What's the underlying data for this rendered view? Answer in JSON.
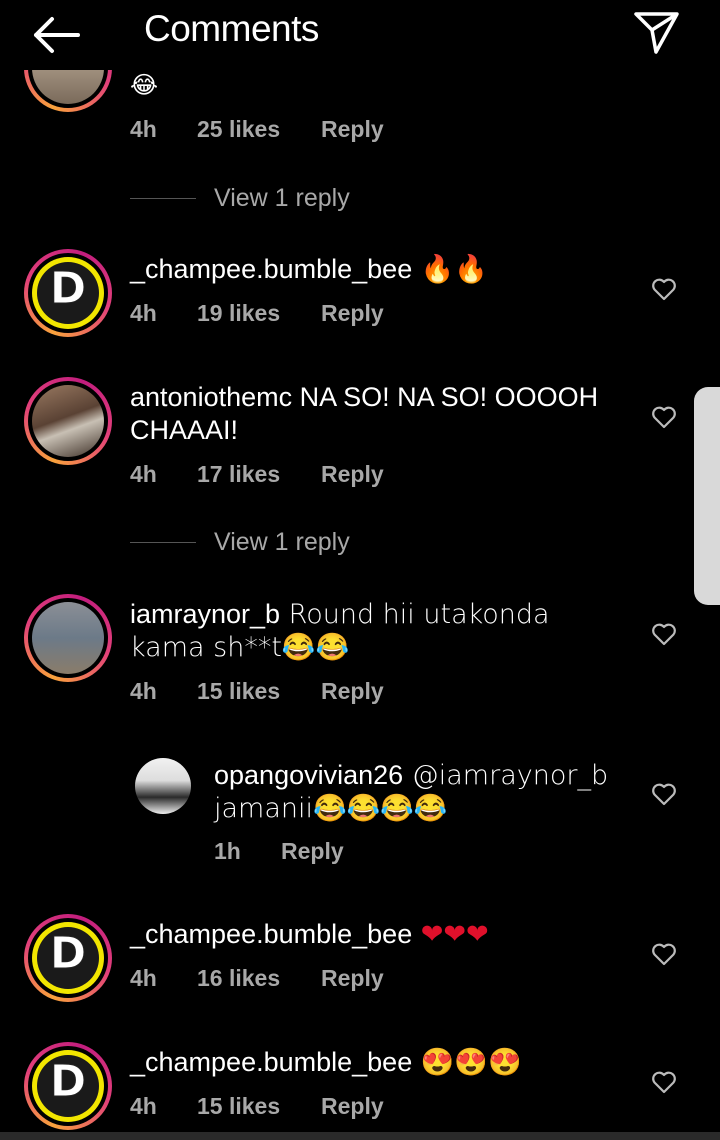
{
  "header": {
    "title": "Comments",
    "back_icon": "arrow-left-icon",
    "send_icon": "paper-plane-icon"
  },
  "top_comment": {
    "text_fragment": "😂",
    "time": "4h",
    "likes": "25 likes",
    "reply": "Reply"
  },
  "view_reply_1": "View 1 reply",
  "view_reply_2": "View 1 reply",
  "comments": [
    {
      "username": "_champee.bumble_bee",
      "text": " 🔥🔥",
      "time": "4h",
      "likes": "19 likes",
      "reply": "Reply"
    },
    {
      "username": "antoniothemc",
      "text": " NA SO! NA SO! OOOOH CHAAAI!",
      "time": "4h",
      "likes": "17 likes",
      "reply": "Reply"
    },
    {
      "username": "iamraynor_b",
      "text": " Round hii utakonda kama sh**t😂😂",
      "time": "4h",
      "likes": "15 likes",
      "reply": "Reply"
    },
    {
      "username": "opangovivian26",
      "text": " @iamraynor_b jamanii😂😂😂😂",
      "time": "1h",
      "likes": "",
      "reply": "Reply"
    },
    {
      "username": "_champee.bumble_bee",
      "text": " ❤❤❤",
      "time": "4h",
      "likes": "16 likes",
      "reply": "Reply"
    },
    {
      "username": "_champee.bumble_bee",
      "text": " 😍😍😍",
      "time": "4h",
      "likes": "15 likes",
      "reply": "Reply"
    }
  ],
  "logo_letter": "D",
  "colors": {
    "background": "#000000",
    "meta_text": "#a8a8a8",
    "story_ring_start": "#f9a23c",
    "story_ring_end": "#c21d7e",
    "logo_yellow": "#f2e600"
  }
}
